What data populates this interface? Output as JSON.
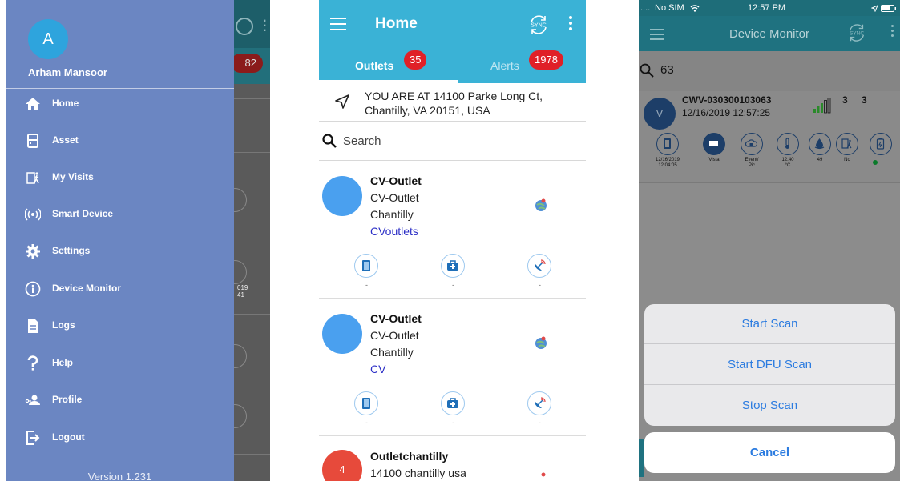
{
  "drawer": {
    "avatar_letter": "A",
    "user_name": "Arham Mansoor",
    "items": [
      {
        "label": "Home",
        "icon": "home-icon"
      },
      {
        "label": "Asset",
        "icon": "asset-icon"
      },
      {
        "label": "My Visits",
        "icon": "visits-icon"
      },
      {
        "label": "Smart Device",
        "icon": "smart-device-icon"
      },
      {
        "label": "Settings",
        "icon": "gear-icon"
      },
      {
        "label": "Device Monitor",
        "icon": "info-icon"
      },
      {
        "label": "Logs",
        "icon": "document-icon"
      },
      {
        "label": "Help",
        "icon": "question-icon"
      },
      {
        "label": "Profile",
        "icon": "profile-icon"
      },
      {
        "label": "Logout",
        "icon": "logout-icon"
      }
    ],
    "version": "Version 1.231",
    "background_peek": {
      "badge": "82",
      "tiny_text": "019\n41"
    }
  },
  "home": {
    "title": "Home",
    "tabs": [
      {
        "label": "Outlets",
        "badge": "35",
        "active": true
      },
      {
        "label": "Alerts",
        "badge": "1978",
        "active": false
      }
    ],
    "location_text": "YOU ARE AT 14100 Parke Long Ct, Chantilly, VA 20151, USA",
    "search_placeholder": "Search",
    "outlets": [
      {
        "avatar": "",
        "avatar_color": "#4aa0ef",
        "name": "CV-Outlet",
        "line2": "CV-Outlet",
        "line3": "Chantilly",
        "link": "CVoutlets"
      },
      {
        "avatar": "",
        "avatar_color": "#4aa0ef",
        "name": "CV-Outlet",
        "line2": "CV-Outlet",
        "line3": "Chantilly",
        "link": "CV"
      },
      {
        "avatar": "4",
        "avatar_color": "#e74a3b",
        "name": "Outletchantilly",
        "line2": "14100 chantilly usa",
        "line3": "",
        "link": ""
      }
    ],
    "icon_row_dashes": [
      "-",
      "-",
      "-"
    ],
    "colors": {
      "primary": "#3ab2d6",
      "badge": "#e02027",
      "link": "#2c2fc6"
    }
  },
  "monitor": {
    "status": {
      "carrier": "No SIM",
      "time": "12:57 PM"
    },
    "title": "Device Monitor",
    "search_value": "63",
    "device": {
      "avatar_letter": "V",
      "serial": "CWV-030300103063",
      "datetime": "12/16/2019  12:57:25",
      "num1": "3",
      "num2": "3",
      "captions": [
        "12/16/2019\n12:04:05",
        "Vista",
        "Event/\nPic",
        "12.40\n°C",
        "49",
        "No",
        ""
      ]
    },
    "actions": [
      "Start Scan",
      "Start DFU Scan",
      "Stop Scan"
    ],
    "cancel": "Cancel",
    "colors": {
      "action": "#2c7ce0",
      "nav": "#1f7280"
    }
  }
}
